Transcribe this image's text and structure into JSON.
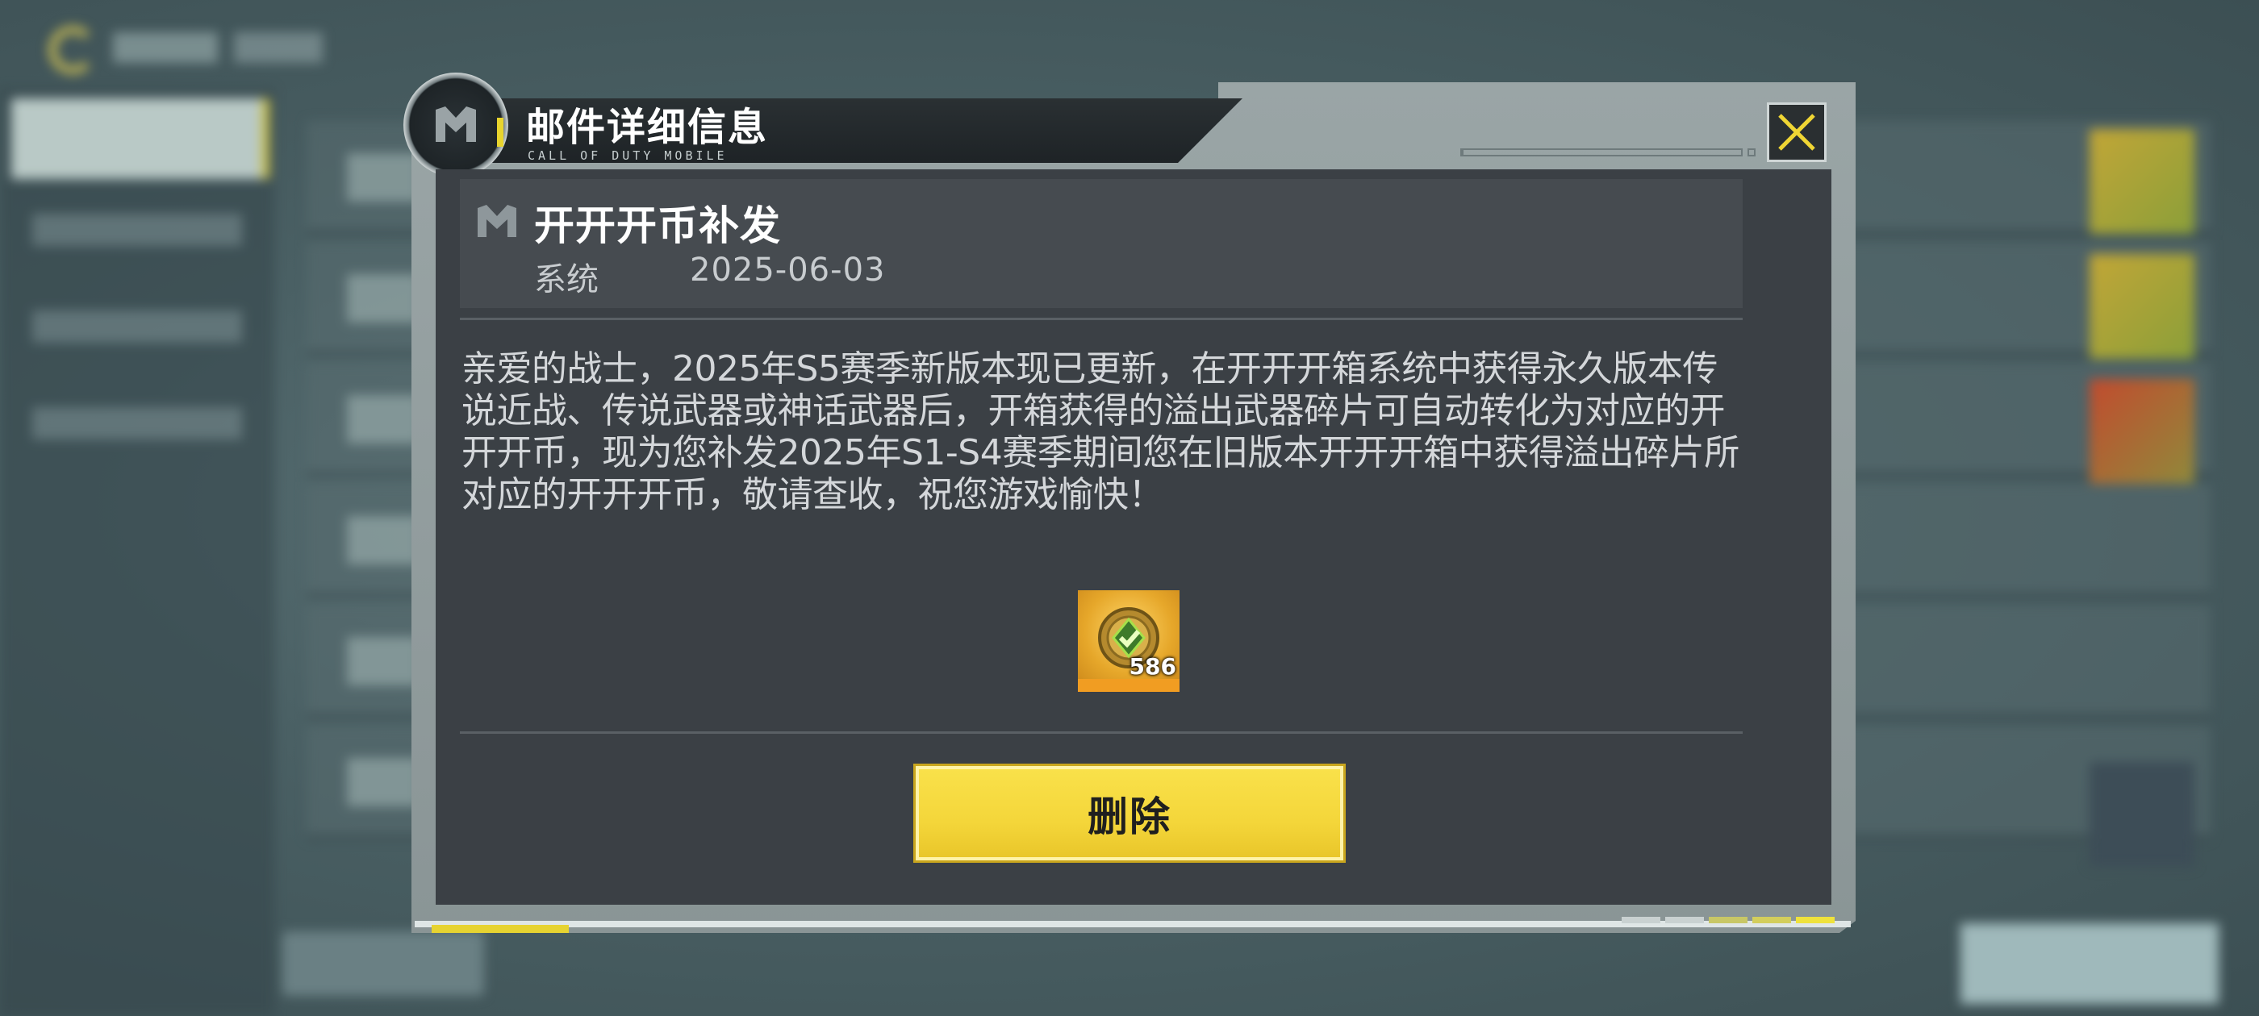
{
  "dialog": {
    "title": "邮件详细信息",
    "subtitle": "CALL OF DUTY MOBILE",
    "close_icon": "close-x-icon"
  },
  "mail": {
    "title": "开开开币补发",
    "sender": "系统",
    "date": "2025-06-03",
    "body": "亲爱的战士，2025年S5赛季新版本现已更新，在开开开箱系统中获得永久版本传说近战、传说武器或神话武器后，开箱获得的溢出武器碎片可自动转化为对应的开开开币，现为您补发2025年S1-S4赛季期间您在旧版本开开开箱中获得溢出碎片所对应的开开开币，敬请查收，祝您游戏愉快！"
  },
  "reward": {
    "icon": "kaikai-coin-icon",
    "count": "586"
  },
  "actions": {
    "delete_label": "删除"
  },
  "colors": {
    "accent_yellow": "#f4d63a",
    "panel_bg": "#3b4045",
    "frame": "#9aa5a6"
  }
}
